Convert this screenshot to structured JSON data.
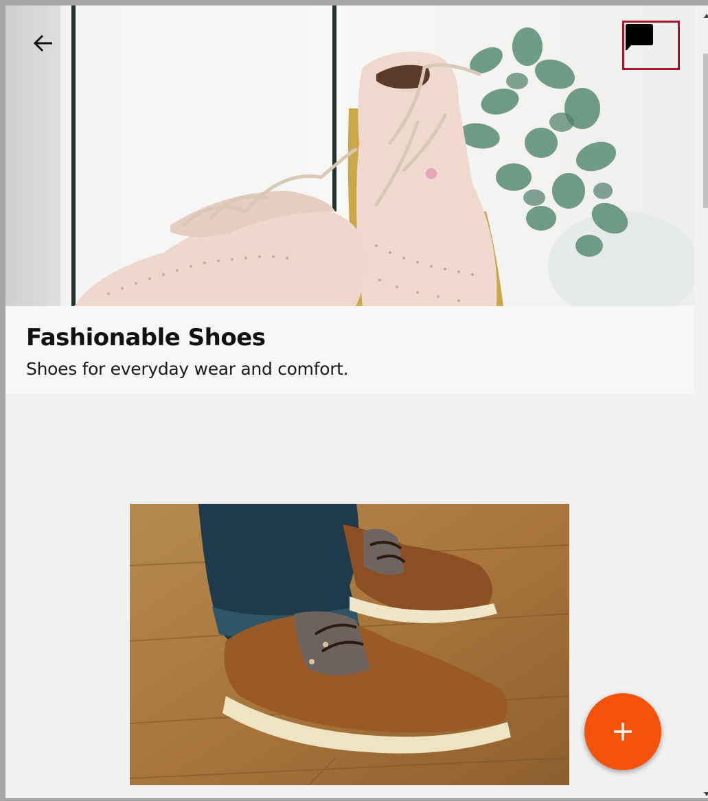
{
  "header": {
    "back_icon": "arrow-left-icon",
    "chat_icon": "chat-bubble-icon"
  },
  "card": {
    "title": "Fashionable Shoes",
    "description": "Shoes for everyday wear and comfort."
  },
  "fab": {
    "label": "+",
    "icon": "plus-icon",
    "color": "#f4510b"
  },
  "colors": {
    "highlight_border": "#a3192b",
    "background": "#f1f1f1"
  }
}
